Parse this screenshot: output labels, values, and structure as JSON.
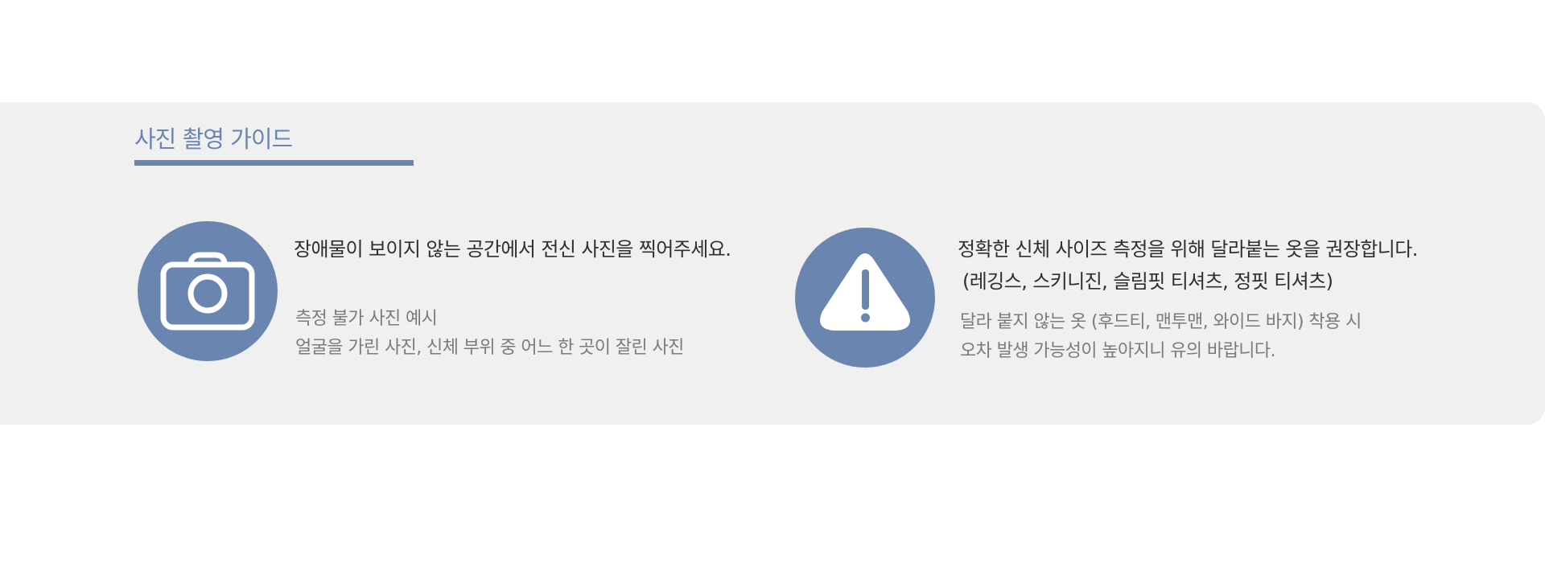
{
  "guide": {
    "title": "사진 촬영 가이드",
    "accent_color": "#6a86b0",
    "background_color": "#f0f0f0"
  },
  "items": [
    {
      "icon": "camera-icon",
      "headline": "장애물이 보이지 않는 공간에서 전신 사진을 찍어주세요.",
      "details": [
        "측정 불가 사진 예시",
        "얼굴을 가린 사진, 신체 부위 중 어느 한 곳이 잘린 사진"
      ]
    },
    {
      "icon": "warning-icon",
      "headline": "정확한 신체 사이즈 측정을 위해 달라붙는 옷을 권장합니다.",
      "headline_line2": "(레깅스, 스키니진, 슬림핏 티셔츠, 정핏 티셔츠)",
      "details": [
        "달라 붙지 않는 옷 (후드티, 맨투맨, 와이드 바지) 착용 시",
        "오차 발생 가능성이 높아지니 유의 바랍니다."
      ]
    }
  ]
}
